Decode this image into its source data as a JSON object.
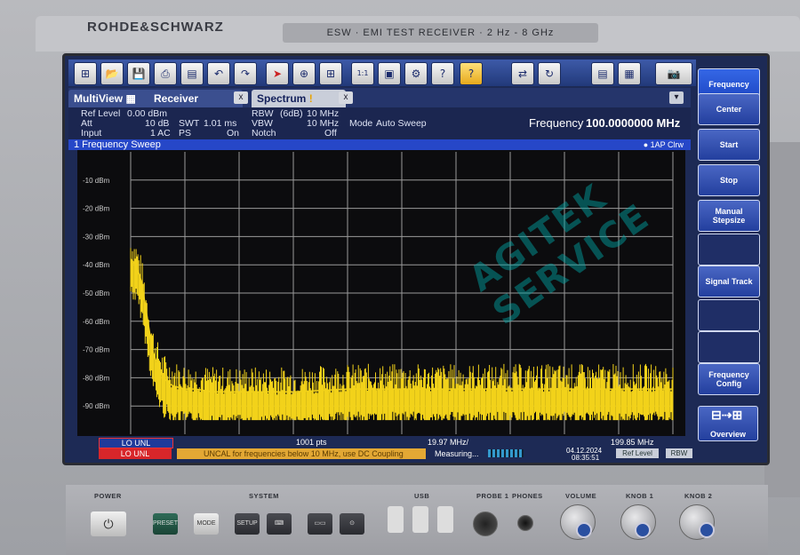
{
  "device": {
    "brand": "ROHDE&SCHWARZ",
    "model": "ESW · EMI TEST RECEIVER · 2 Hz - 8 GHz"
  },
  "toolbar": {
    "icons": [
      "windows-icon",
      "open-icon",
      "save-icon",
      "print-icon",
      "clipboard-icon",
      "undo-icon",
      "redo-icon",
      "select-icon",
      "zoom-icon",
      "multi-zoom-icon",
      "zoom-1to1-icon",
      "screenshot-icon",
      "setup-icon",
      "help-pointer-icon",
      "help-icon",
      "transducer-icon",
      "refresh-icon",
      "sequencer-icon",
      "record-icon",
      "camera-icon"
    ]
  },
  "tabs": [
    {
      "label": "MultiView"
    },
    {
      "label": "Receiver"
    },
    {
      "label": "Spectrum",
      "badge": "!"
    }
  ],
  "tab_dropdown": "▾",
  "settings": {
    "ref_level_label": "Ref Level",
    "ref_level": "0.00 dBm",
    "att_label": "Att",
    "att": "10 dB",
    "swt_label": "SWT",
    "swt": "1.01 ms",
    "input_label": "Input",
    "input": "1 AC",
    "ps_label": "PS",
    "ps": "On",
    "rbw_label": "RBW",
    "rbw_mode": "(6dB)",
    "rbw": "10 MHz",
    "vbw_label": "VBW",
    "vbw": "10 MHz",
    "notch_label": "Notch",
    "notch": "Off",
    "mode_label": "Mode",
    "mode": "Auto Sweep",
    "frequency_label": "Frequency",
    "frequency": "100.0000000 MHz"
  },
  "sweep": {
    "title": "1 Frequency Sweep",
    "trace_label": "● 1AP Clrw"
  },
  "chart_data": {
    "type": "line",
    "yticks": [
      "-10 dBm",
      "-20 dBm",
      "-30 dBm",
      "-40 dBm",
      "-50 dBm",
      "-60 dBm",
      "-70 dBm",
      "-80 dBm",
      "-90 dBm"
    ],
    "ylim": [
      -100,
      0
    ],
    "x_start_label": "LO UNL",
    "points_label": "1001 pts",
    "span_label": "19.97 MHz/",
    "stop_label": "199.85 MHz",
    "trace_color": "#f2d21a",
    "series": [
      {
        "x": [
          0,
          1,
          2,
          3,
          4,
          5,
          6,
          7,
          8,
          10,
          12,
          15,
          20,
          25,
          30,
          40,
          50,
          60,
          70,
          80,
          90,
          100
        ],
        "y": [
          -38,
          -40,
          -46,
          -58,
          -70,
          -76,
          -80,
          -82,
          -83,
          -84,
          -84,
          -85,
          -85,
          -85,
          -85,
          -84,
          -84,
          -84,
          -84,
          -84,
          -84,
          -84
        ]
      }
    ],
    "noise_floor_low": -95,
    "noise_floor_high": -75
  },
  "softkeys": [
    {
      "label": "Frequency"
    },
    {
      "label": "Center"
    },
    {
      "label": "Start"
    },
    {
      "label": "Stop"
    },
    {
      "label": "Manual Stepsize"
    },
    {
      "label": ""
    },
    {
      "label": "Signal Track"
    },
    {
      "label": ""
    },
    {
      "label": ""
    },
    {
      "label": "Frequency Config"
    },
    {
      "label": "Overview"
    }
  ],
  "status": {
    "lo_unl_1": "LO UNL",
    "lo_unl_2": "LO UNL",
    "message": "UNCAL for frequencies below 10 MHz, use DC Coupling",
    "measuring": "Measuring...",
    "date": "04.12.2024",
    "time": "08:35:51",
    "ref_level_btn": "Ref Level",
    "rbw_btn": "RBW"
  },
  "front_panel": {
    "power": "POWER",
    "system": "SYSTEM",
    "usb": "USB",
    "probe": "PROBE 1",
    "phones": "PHONES",
    "volume": "VOLUME",
    "knob1": "KNOB 1",
    "knob2": "KNOB 2",
    "preset": "PRESET",
    "mode": "MODE",
    "setup": "SETUP",
    "keyboard": "⌨"
  },
  "watermark": "AGITEK SERVICE",
  "colors": {
    "trace": "#f2d21a",
    "screen_bg": "#1d2a55",
    "sweep_bar": "#2647c8",
    "grid": "#9a9a9a"
  }
}
